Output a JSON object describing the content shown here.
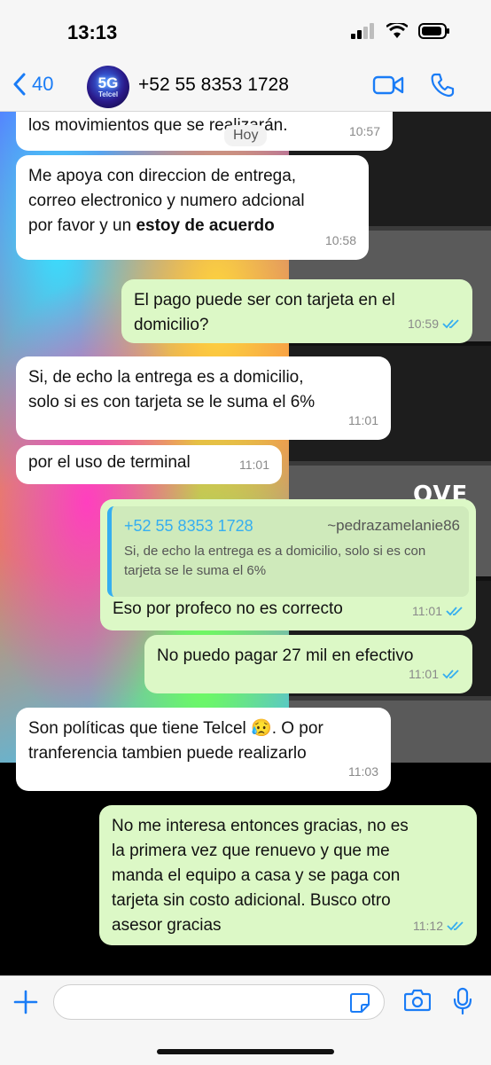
{
  "status_bar": {
    "time": "13:13"
  },
  "header": {
    "back_count": "40",
    "contact_name": "+52 55 8353 1728",
    "avatar_text_main": "5G",
    "avatar_text_sub": "Telcel"
  },
  "date_chip": "Hoy",
  "wallpaper": {
    "art_text": "OVE"
  },
  "messages": [
    {
      "dir": "in",
      "text": "los movimientos que se realizarán.",
      "time": "10:57"
    },
    {
      "dir": "in",
      "text_a": "Me apoya con direccion de entrega,\ncorreo electronico y numero adcional\npor favor y un ",
      "text_bold": "estoy de acuerdo",
      "time": "10:58"
    },
    {
      "dir": "out",
      "text": "El pago puede ser con tarjeta en el\ndomicilio?",
      "time": "10:59"
    },
    {
      "dir": "in",
      "text": "Si, de echo la entrega es a domicilio,\nsolo si es con tarjeta se le suma el 6%",
      "time": "11:01"
    },
    {
      "dir": "in",
      "text": "por el uso de terminal",
      "time": "11:01"
    },
    {
      "dir": "out",
      "quote_name": "+52 55 8353 1728",
      "quote_user": "~pedrazamelanie86",
      "quote_text": "Si, de echo la entrega es a domicilio, solo si es con tarjeta se le suma el 6%",
      "text": "Eso por profeco no es correcto",
      "time": "11:01"
    },
    {
      "dir": "out",
      "text": "No puedo pagar 27 mil en efectivo",
      "time": "11:01"
    },
    {
      "dir": "in",
      "text": "Son políticas que tiene Telcel 😥. O por\ntranferencia tambien puede realizarlo",
      "time": "11:03"
    },
    {
      "dir": "out",
      "text": "No me interesa entonces gracias, no es\nla primera vez que renuevo y que me\nmanda el equipo a casa y se paga con\ntarjeta sin costo adicional. Busco otro\nasesor gracias",
      "time": "11:12"
    }
  ],
  "colors": {
    "accent": "#1a7cf6",
    "outgoing_bubble": "#dcf8c6",
    "incoming_bubble": "#ffffff",
    "read_ticks": "#35aef0"
  }
}
